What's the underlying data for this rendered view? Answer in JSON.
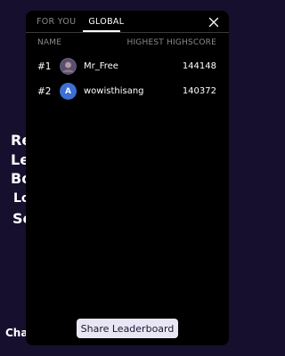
{
  "background": {
    "lines": [
      "Re",
      "Le",
      "Bo",
      "Lo",
      "Se",
      "Chan"
    ]
  },
  "tabs": [
    {
      "label": "FOR YOU",
      "active": false
    },
    {
      "label": "GLOBAL",
      "active": true
    }
  ],
  "columns": {
    "name": "NAME",
    "score": "HIGHEST HIGHSCORE"
  },
  "rows": [
    {
      "rank": "#1",
      "avatar": "user-photo-icon",
      "name": "Mr_Free",
      "score": "144148"
    },
    {
      "rank": "#2",
      "avatar_letter": "A",
      "name": "wowisthisang",
      "score": "140372"
    }
  ],
  "share_button": "Share Leaderboard",
  "colors": {
    "page_bg": "#160f2e",
    "modal_bg": "#000000",
    "avatar_blue": "#3d6fd4",
    "button_bg": "#e8e6f4"
  }
}
